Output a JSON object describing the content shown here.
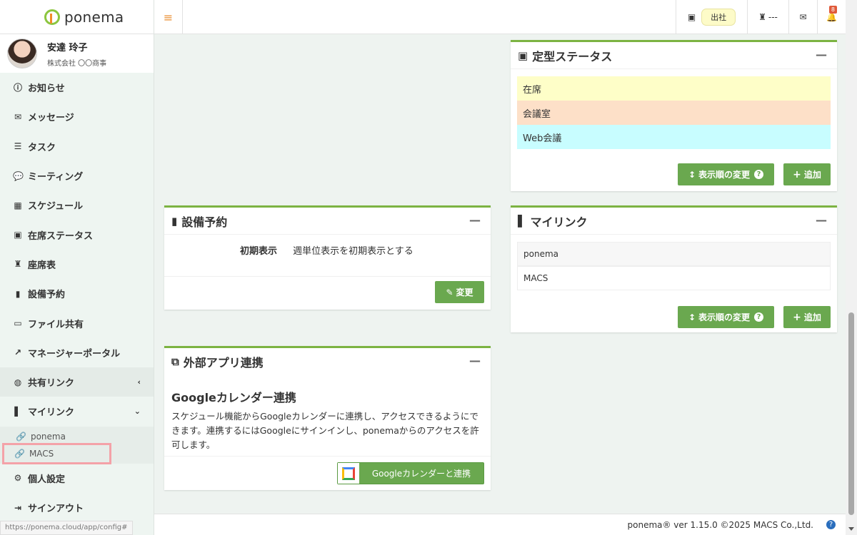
{
  "app": {
    "name": "ponema"
  },
  "user": {
    "name": "安達 玲子",
    "company": "株式会社 〇〇商事"
  },
  "sidebar": {
    "items": [
      {
        "label": "お知らせ",
        "icon": "info-icon"
      },
      {
        "label": "メッセージ",
        "icon": "mail-icon"
      },
      {
        "label": "タスク",
        "icon": "task-list-icon"
      },
      {
        "label": "ミーティング",
        "icon": "chat-icon"
      },
      {
        "label": "スケジュール",
        "icon": "calendar-icon"
      },
      {
        "label": "在席ステータス",
        "icon": "presence-icon"
      },
      {
        "label": "座席表",
        "icon": "seat-icon"
      },
      {
        "label": "設備予約",
        "icon": "door-icon"
      },
      {
        "label": "ファイル共有",
        "icon": "folder-icon"
      },
      {
        "label": "マネージャーポータル",
        "icon": "chart-icon"
      },
      {
        "label": "共有リンク",
        "icon": "globe-icon"
      },
      {
        "label": "マイリンク",
        "icon": "bookmark-icon"
      },
      {
        "label": "個人設定",
        "icon": "gear-icon"
      },
      {
        "label": "サインアウト",
        "icon": "signout-icon"
      }
    ],
    "mylinks": [
      {
        "label": "ponema"
      },
      {
        "label": "MACS"
      }
    ],
    "status_url": "https://ponema.cloud/app/config#"
  },
  "topbar": {
    "attendance_label": "出社",
    "seat_label": "---",
    "notification_count": "8"
  },
  "cards": {
    "status": {
      "title": "定型ステータス",
      "rows": [
        {
          "label": "在席",
          "color": "#fefec8"
        },
        {
          "label": "会議室",
          "color": "#fde0c8"
        },
        {
          "label": "Web会議",
          "color": "#c8fdff"
        }
      ],
      "reorder_label": "表示順の変更",
      "add_label": "追加"
    },
    "facility": {
      "title": "設備予約",
      "setting_label": "初期表示",
      "setting_value": "週単位表示を初期表示とする",
      "change_label": "変更"
    },
    "mylink": {
      "title": "マイリンク",
      "links": [
        {
          "label": "ponema"
        },
        {
          "label": "MACS"
        }
      ],
      "reorder_label": "表示順の変更",
      "add_label": "追加"
    },
    "external": {
      "title": "外部アプリ連携",
      "heading": "Googleカレンダー連携",
      "description": "スケジュール機能からGoogleカレンダーに連携し、アクセスできるようにできます。連携するにはGoogleにサインインし、ponemaからのアクセスを許可します。",
      "connect_label": "Googleカレンダーと連携"
    }
  },
  "footer": {
    "text": "ponema® ver 1.15.0 ©2025 MACS Co.,Ltd."
  },
  "colors": {
    "accent": "#6aa84f",
    "card_border": "#7cb342",
    "highlight": "#f4a2a8"
  }
}
